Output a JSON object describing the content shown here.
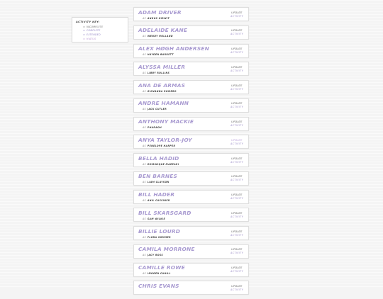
{
  "key": {
    "title": "Activity Key:",
    "items": [
      {
        "symbol": "×",
        "label": "Incomplete",
        "color": "#6b6b6b"
      },
      {
        "symbol": "×",
        "label": "Complete",
        "color": "#8a7cc0"
      },
      {
        "symbol": "×",
        "label": "Extended",
        "color": "#8a7cc0"
      },
      {
        "symbol": "×",
        "label": "Hiatus",
        "color": "#b48fd0"
      }
    ]
  },
  "cards": [
    {
      "name": "Adam Driver",
      "as": "as",
      "character": "Angus Hirwit",
      "update": "Update",
      "activity": "Activity"
    },
    {
      "name": "Adelaide Kane",
      "as": "as",
      "character": "Wendy Holland",
      "update": "Update",
      "activity": "Activity"
    },
    {
      "name": "Alex Høgh Andersen",
      "as": "as",
      "character": "Hayden Barrett",
      "update": "Update",
      "activity": "Activity"
    },
    {
      "name": "Alyssa Miller",
      "as": "as",
      "character": "Libby Rollins",
      "update": "Update",
      "activity": "Activity"
    },
    {
      "name": "Ana de Armas",
      "as": "as",
      "character": "Giovanna Romero",
      "update": "Update",
      "activity": "Activity"
    },
    {
      "name": "Andre Hamann",
      "as": "as",
      "character": "Jack Cutler",
      "update": "Update",
      "activity": "Activity"
    },
    {
      "name": "Anthony Mackie",
      "as": "as",
      "character": "Pharaoh",
      "update": "Update",
      "activity": "Activity"
    },
    {
      "name": "Anya Taylor-Joy",
      "as": "as",
      "character": "Penelope Harper",
      "update": "Update",
      "activity": "Activity",
      "highlight": true
    },
    {
      "name": "Bella Hadid",
      "as": "as",
      "character": "Dominique Mazzari",
      "update": "Update",
      "activity": "Activity"
    },
    {
      "name": "Ben Barnes",
      "as": "as",
      "character": "Liam Clayson",
      "update": "Update",
      "activity": "Activity"
    },
    {
      "name": "Bill Hader",
      "as": "as",
      "character": "Anil Cassiner",
      "update": "Update",
      "activity": "Activity"
    },
    {
      "name": "Bill Skarsgard",
      "as": "as",
      "character": "Sam Wilkie",
      "update": "Update",
      "activity": "Activity"
    },
    {
      "name": "Billie Lourd",
      "as": "as",
      "character": "Flora Sommer",
      "update": "Update",
      "activity": "Activity"
    },
    {
      "name": "Camila Morrone",
      "as": "as",
      "character": "Jacy Ross",
      "update": "Update",
      "activity": "Activity"
    },
    {
      "name": "Camille Rowe",
      "as": "as",
      "character": "Imogen Cahill",
      "update": "Update",
      "activity": "Activity"
    },
    {
      "name": "Chris Evans",
      "as": "",
      "character": "",
      "update": "Update",
      "activity": "Activity"
    }
  ]
}
